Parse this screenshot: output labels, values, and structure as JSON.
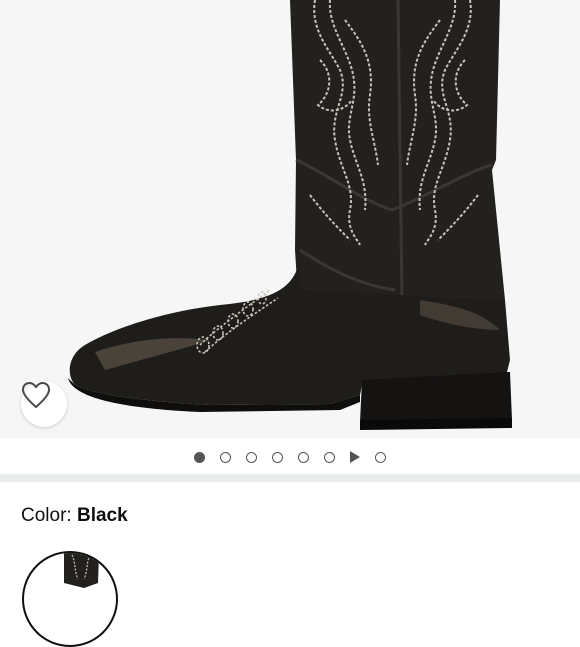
{
  "product": {
    "image_icon": "cowboy-boot-photo",
    "carousel": {
      "total_dots": 8,
      "active_index": 0,
      "video_index": 6
    },
    "wishlist_icon": "heart-outline-icon"
  },
  "variation": {
    "color_label": "Color: ",
    "color_value": "Black",
    "selected_swatch_icon": "boot-swatch-thumbnail"
  },
  "colors": {
    "image_background": "#f6f6f6",
    "boot_leather": "#1f1d1a",
    "stitching": "#c9c4ba",
    "divider": "#eaeded",
    "text": "#0f1111"
  }
}
